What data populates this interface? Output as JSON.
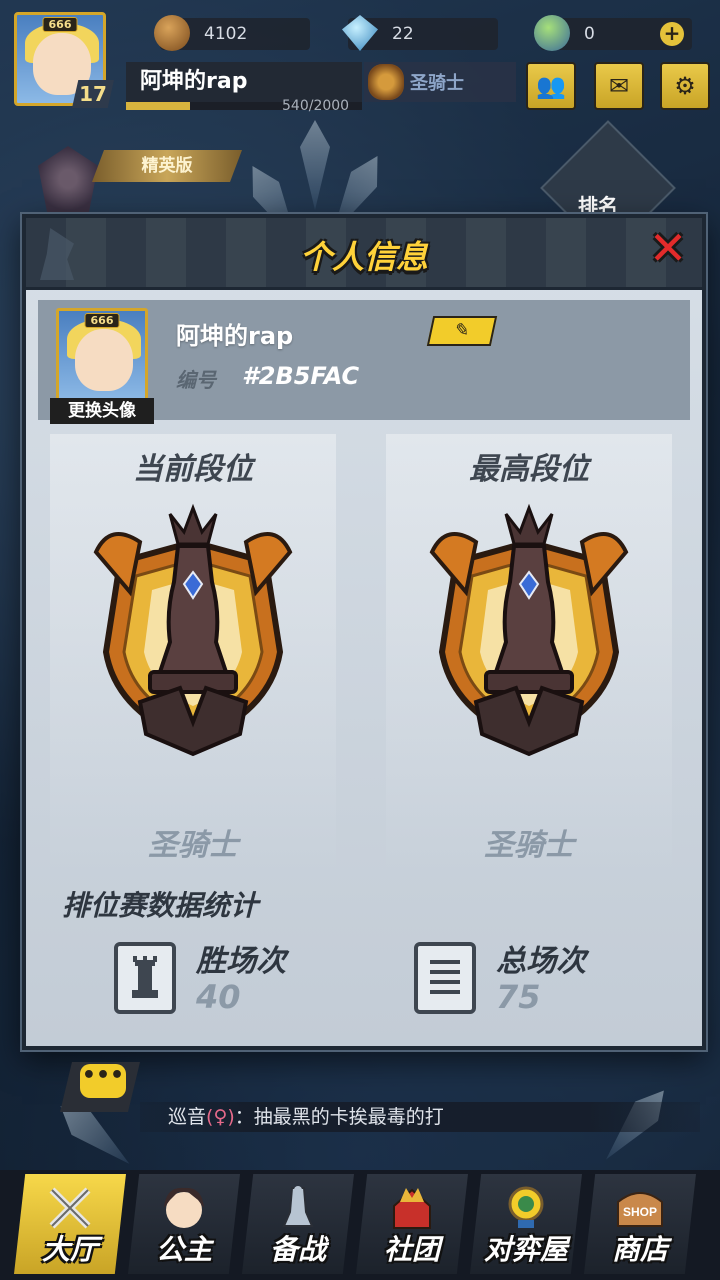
{
  "hud": {
    "avatar_badge": "666",
    "level": "17",
    "coins": "4102",
    "gems": "22",
    "special_currency": "0",
    "player_name": "阿坤的rap",
    "exp_text": "540/2000",
    "exp_progress": 0.27,
    "rank_label": "圣骑士",
    "elite_label": "精英版",
    "rank_tab_label": "排名"
  },
  "modal": {
    "title": "个人信息",
    "profile": {
      "avatar_badge": "666",
      "change_avatar_label": "更换头像",
      "name": "阿坤的rap",
      "id_label": "编号",
      "id_value": "#2B5FAC"
    },
    "current_rank": {
      "title": "当前段位",
      "name": "圣骑士"
    },
    "highest_rank": {
      "title": "最高段位",
      "name": "圣骑士"
    },
    "stats": {
      "title": "排位赛数据统计",
      "wins_label": "胜场次",
      "wins_value": "40",
      "total_label": "总场次",
      "total_value": "75"
    }
  },
  "chat": {
    "speaker": "巡音",
    "open_paren": "(",
    "gender_symbol": "♀",
    "close_paren": ")",
    "message": "：抽最黑的卡挨最毒的打"
  },
  "nav": [
    {
      "label": "大厅",
      "active": true
    },
    {
      "label": "公主",
      "active": false
    },
    {
      "label": "备战",
      "active": false
    },
    {
      "label": "社团",
      "active": false
    },
    {
      "label": "对弈屋",
      "active": false
    },
    {
      "label": "商店",
      "active": false,
      "badge": "SHOP"
    }
  ],
  "colors": {
    "accent_yellow": "#f2cc2a",
    "title_yellow": "#ffd23a",
    "close_red": "#e32b2b",
    "rank_gray": "#8b99a7"
  }
}
